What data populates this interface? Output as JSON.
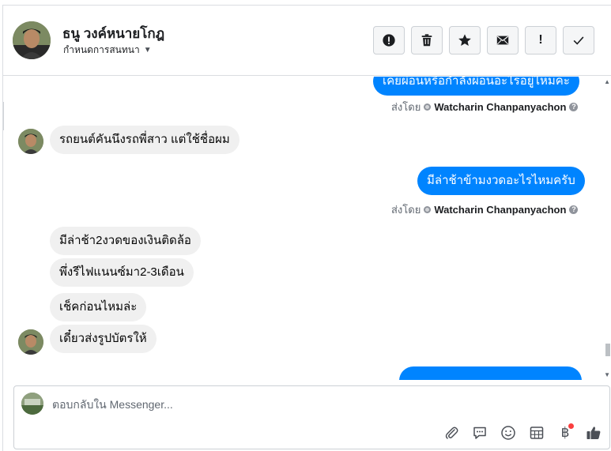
{
  "header": {
    "contact_name": "ธนู วงค์หนายโกฎ",
    "set_conversation_label": "กำหนดการสนทนา"
  },
  "actions": [
    {
      "name": "spam-button",
      "icon": "alert-circle-icon"
    },
    {
      "name": "delete-button",
      "icon": "trash-icon"
    },
    {
      "name": "star-button",
      "icon": "star-icon"
    },
    {
      "name": "mark-unread-button",
      "icon": "envelope-icon"
    },
    {
      "name": "important-button",
      "icon": "exclamation-icon",
      "glyph": "!"
    },
    {
      "name": "mark-done-button",
      "icon": "checkmark-icon"
    }
  ],
  "conversation": {
    "outgoing_partial_top": "เคยผ่อนหรือกำลังผ่อนอะไรอยู่ไหมคะ",
    "sent_by_prefix": "ส่งโดย",
    "sender": "Watcharin Chanpanyachon",
    "incoming_1": "รถยนต์คันนึงรถพี่สาว แต่ใช้ชื่อผม",
    "outgoing_1": "มีล่าช้าข้ามงวดอะไรไหมครับ",
    "incoming_2": "มีล่าช้า2งวดของเงินติดล้อ",
    "incoming_3": "พึ่งรีไฟแนนซ์มา2-3เดือน",
    "incoming_4": "เช็คก่อนไหมล่ะ",
    "incoming_5": "เดี๋ยวส่งรูปบัตรให้"
  },
  "composer": {
    "placeholder": "ตอบกลับใน Messenger..."
  },
  "colors": {
    "outgoing_bubble": "#0084ff",
    "incoming_bubble": "#f0f0f0",
    "border": "#ccd0d5"
  }
}
